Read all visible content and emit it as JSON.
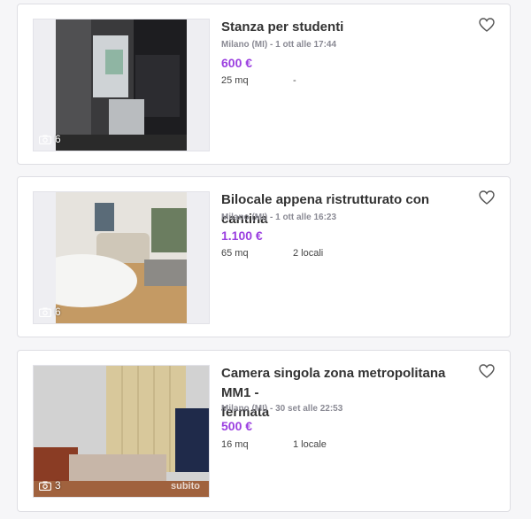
{
  "listings": [
    {
      "title": "Stanza per studenti",
      "meta": "Milano (MI) - 1 ott alle 17:44",
      "price": "600 €",
      "size": "25 mq",
      "rooms": "-",
      "photo_count": "6"
    },
    {
      "title": "Bilocale appena ristrutturato con cantina",
      "meta": "Milano (MI) - 1 ott alle 16:23",
      "price": "1.100 €",
      "size": "65 mq",
      "rooms": "2 locali",
      "photo_count": "6"
    },
    {
      "title_line1": "Camera singola zona metropolitana MM1 -",
      "title_line2": "fermata",
      "meta": "Milano (MI) - 30 set alle 22:53",
      "price": "500 €",
      "size": "16 mq",
      "rooms": "1 locale",
      "photo_count": "3",
      "watermark": "subito"
    }
  ],
  "colors": {
    "price": "#9b3fe0",
    "background": "#f6f6f8",
    "card": "#ffffff"
  },
  "icons": [
    "camera-icon",
    "heart-icon"
  ]
}
